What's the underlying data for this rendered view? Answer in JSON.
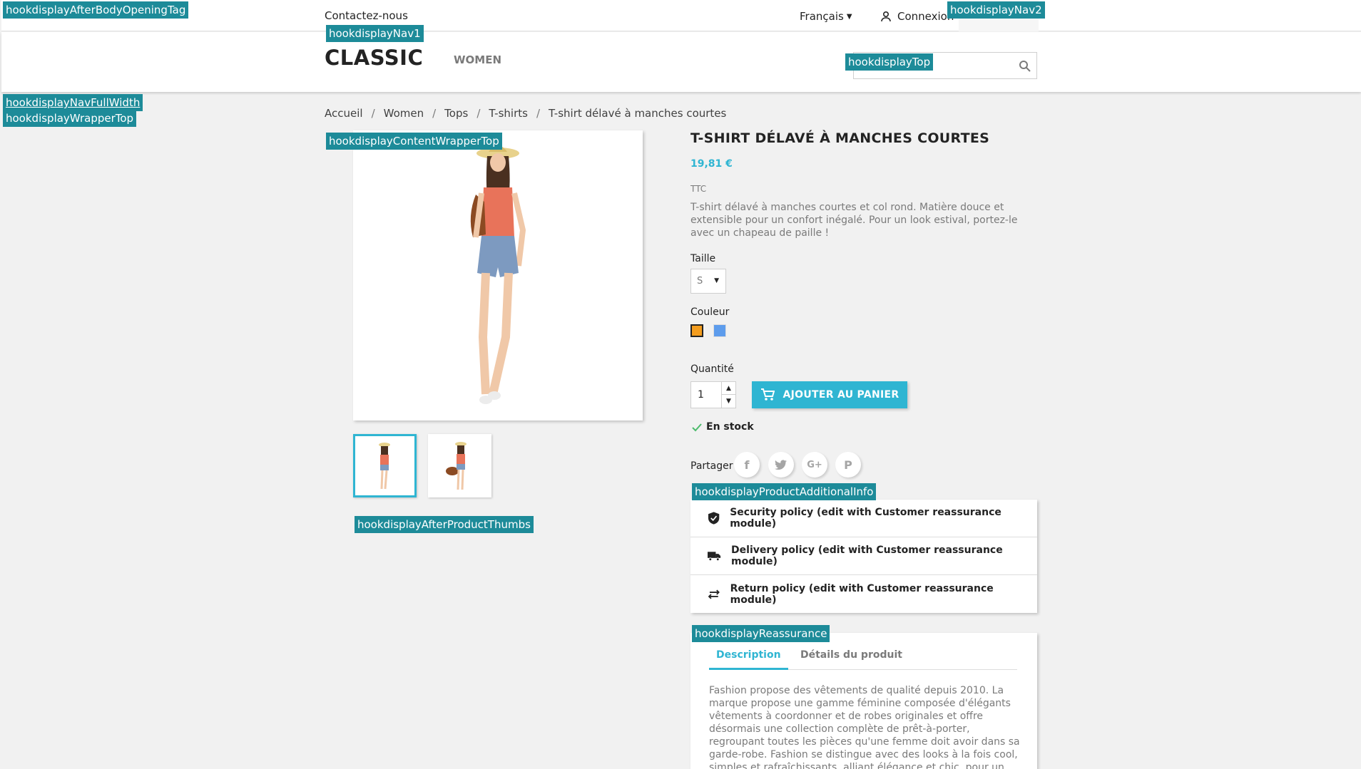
{
  "hooks": {
    "after_body": "hookdisplayAfterBodyOpeningTag",
    "nav1": "hookdisplayNav1",
    "nav2": "hookdisplayNav2",
    "top": "hookdisplayTop",
    "nav_full_width": "hookdisplayNavFullWidth",
    "wrapper_top": "hookdisplayWrapperTop",
    "content_wrapper_top": "hookdisplayContentWrapperTop",
    "after_product_thumbs": "hookdisplayAfterProductThumbs",
    "product_additional_info": "hookdisplayProductAdditionalInfo",
    "reassurance": "hookdisplayReassurance"
  },
  "topnav": {
    "contact": "Contactez-nous",
    "language": "Français",
    "login": "Connexion"
  },
  "header": {
    "logo": "CLASSIC",
    "menu": [
      "WOMEN"
    ],
    "search_placeholder": ""
  },
  "breadcrumb": [
    "Accueil",
    "Women",
    "Tops",
    "T-shirts",
    "T-shirt délavé à manches courtes"
  ],
  "product": {
    "title": "T-SHIRT DÉLAVÉ À MANCHES COURTES",
    "price": "19,81 €",
    "tax_label": "TTC",
    "description": "T-shirt délavé à manches courtes et col rond. Matière douce et extensible pour un confort inégalé. Pour un look estival, portez-le avec un chapeau de paille !",
    "size_label": "Taille",
    "size_value": "S",
    "color_label": "Couleur",
    "colors": [
      "#f39d1f",
      "#5d9cec"
    ],
    "quantity_label": "Quantité",
    "quantity": "1",
    "add_to_cart": "AJOUTER AU PANIER",
    "stock": "En stock",
    "share_label": "Partager",
    "social": [
      "facebook-icon",
      "twitter-icon",
      "google-plus-icon",
      "pinterest-icon"
    ]
  },
  "reassurance": [
    "Security policy (edit with Customer reassurance module)",
    "Delivery policy (edit with Customer reassurance module)",
    "Return policy (edit with Customer reassurance module)"
  ],
  "tabs": {
    "items": [
      "Description",
      "Détails du produit"
    ],
    "active_text": "Fashion propose des vêtements de qualité depuis 2010. La marque propose une gamme féminine composée d'élégants vêtements à coordonner et de robes originales et offre désormais une collection complète de prêt-à-porter, regroupant toutes les pièces qu'une femme doit avoir dans sa garde-robe. Fashion se distingue avec des looks à la fois cool, simples et rafraîchissants, alliant élégance et chic, pour un style reconnaissable entre mille. Chacune des"
  },
  "colors": {
    "accent": "#2fb5d2",
    "hook": "#1d8b99"
  }
}
